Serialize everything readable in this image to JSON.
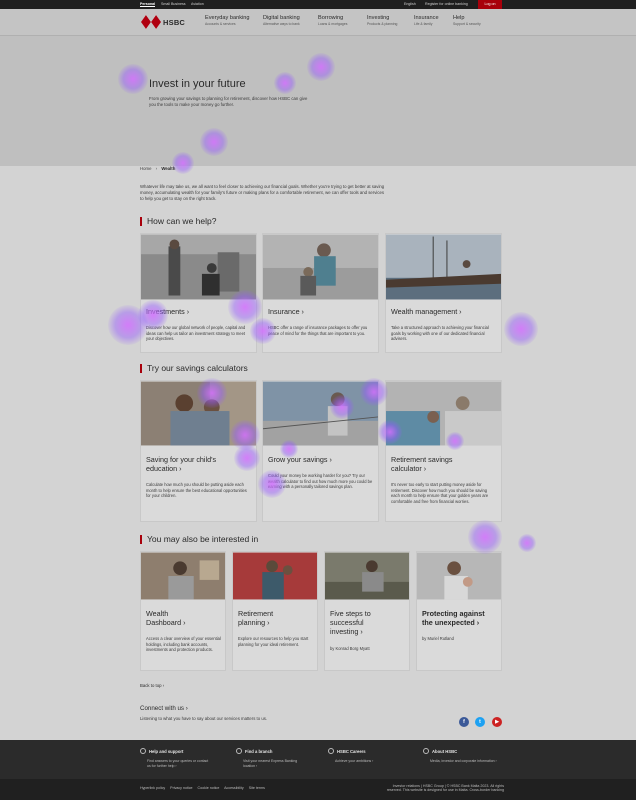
{
  "topbar": {
    "tabs": [
      "Personal",
      "Small Business",
      "Aviation"
    ],
    "language": "English",
    "register": "Register for online banking",
    "logon": "Log on"
  },
  "brand": {
    "name": "HSBC",
    "red": "#db0011"
  },
  "nav": [
    {
      "label": "Everyday banking",
      "sub": "Accounts & services"
    },
    {
      "label": "Digital banking",
      "sub": "Alternative ways to bank"
    },
    {
      "label": "Borrowing",
      "sub": "Loans & mortgages"
    },
    {
      "label": "Investing",
      "sub": "Products & planning"
    },
    {
      "label": "Insurance",
      "sub": "Life & family"
    },
    {
      "label": "Help",
      "sub": "Support & security"
    }
  ],
  "hero": {
    "title": "Invest in your future",
    "text": "From growing your savings to planning for retirement, discover how HSBC can give you the tools to make your money go further."
  },
  "breadcrumb": {
    "home": "Home",
    "current": "Wealth"
  },
  "intro": "Whatever life may take us, we all want to feel closer to achieving our financial goals. Whether you're trying to get better at saving money, accumulating wealth for your family's future or making plans for a comfortable retirement, we can offer tools and services to help you get to stay on the right track.",
  "help": {
    "heading": "How can we help?",
    "cards": [
      {
        "title": "Investments ›",
        "text": "Discover how our global network of people, capital and ideas can help us tailor an investment strategy to meet your objectives."
      },
      {
        "title": "Insurance ›",
        "text": "HSBC offer a range of insurance packages to offer you peace of mind for the things that are important to you."
      },
      {
        "title": "Wealth management ›",
        "text": "Take a structured approach to achieving your financial goals by working with one of our dedicated financial advisers."
      }
    ]
  },
  "calculators": {
    "heading": "Try our savings calculators",
    "cards": [
      {
        "title1": "Saving for your child's",
        "title2": "education ›",
        "text": "Calculate how much you should be putting aside each month to help ensure the best educational opportunities for your children."
      },
      {
        "title1": "Grow your savings ›",
        "title2": "",
        "text": "Could your money be working harder for you? Try our wealth calculator to find out how much more you could be earning with a personally tailored savings plan."
      },
      {
        "title1": "Retirement savings",
        "title2": "calculator ›",
        "text": "It's never too early to start putting money aside for retirement. Discover how much you should be saving each month to help ensure that your golden years are comfortable and free from financial worries."
      }
    ]
  },
  "interest": {
    "heading": "You may also be interested in",
    "cards": [
      {
        "t1": "Wealth",
        "t2": "Dashboard ›",
        "t3": "",
        "text": "Access a clear overview of your essential holdings, including bank accounts, investments and protection products.",
        "byline": ""
      },
      {
        "t1": "Retirement",
        "t2": "planning ›",
        "t3": "",
        "text": "Explore our resources to help you start planning for your ideal retirement.",
        "byline": ""
      },
      {
        "t1": "Five steps to",
        "t2": "successful",
        "t3": "investing ›",
        "text": "",
        "byline": "by Konrad Borg Myatt"
      },
      {
        "t1": "Protecting against",
        "t2": "the unexpected ›",
        "t3": "",
        "text": "",
        "byline": "by Muriel Rutland"
      }
    ]
  },
  "back_to_top": "Back to top ›",
  "connect": {
    "heading": "Connect with us ›",
    "text": "Listening to what you have to say about our services matters to us."
  },
  "footer": [
    {
      "heading": "Help and support",
      "text": "Find answers to your queries or contact us for further help ›"
    },
    {
      "heading": "Find a branch",
      "text": "Visit your nearest Express Banking location ›"
    },
    {
      "heading": "HSBC Careers",
      "text": "Achieve your ambitions ›"
    },
    {
      "heading": "About HSBC",
      "text": "Media, investor and corporate information ›"
    }
  ],
  "legal": {
    "links": [
      "Hyperlink policy",
      "Privacy notice",
      "Cookie notice",
      "Accessibility",
      "Site terms"
    ],
    "right1": "Investor relations | HSBC Group | © HSBC Bank Malta 2023. All rights",
    "right2": "reserved. This website is designed for use in Malta. Cross-border banking"
  }
}
